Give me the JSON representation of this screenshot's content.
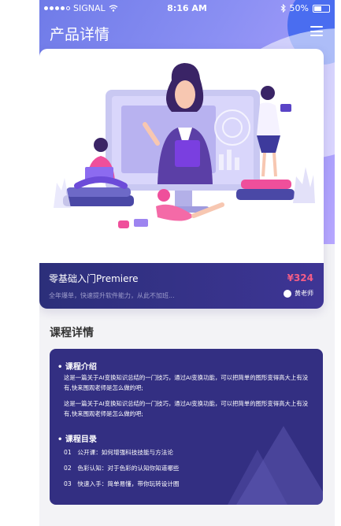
{
  "status_bar": {
    "carrier": "SIGNAL",
    "time": "8:16 AM",
    "battery": "50%"
  },
  "header": {
    "title": "产品详情"
  },
  "course": {
    "name": "零基础入门Premiere",
    "description": "全年爆单，快速提升软件能力，从此不加班...",
    "price": "¥324",
    "teacher": "黄老师"
  },
  "details": {
    "title": "课程详情",
    "intro_heading": "课程介绍",
    "intro_paragraphs": [
      "这是一篇关于AI变换知识总结的一门技巧，通过AI变换功能，可以把简单的图形变得高大上有没有,快来围观老师是怎么做的吧;",
      "这是一篇关于AI变换知识总结的一门技巧，通过AI变换功能，可以把简单的图形变得高大上有没有,快来围观老师是怎么做的吧;"
    ],
    "outline_heading": "课程目录",
    "outline": [
      {
        "num": "01",
        "text": "公开课：如何增强科技技能与方法论"
      },
      {
        "num": "02",
        "text": "色彩认知：对于色彩的认知你知道哪些"
      },
      {
        "num": "03",
        "text": "快速入手：简单易懂，带你玩转设计圈"
      }
    ]
  },
  "colors": {
    "accent": "#332f82",
    "price": "#f45d86"
  }
}
